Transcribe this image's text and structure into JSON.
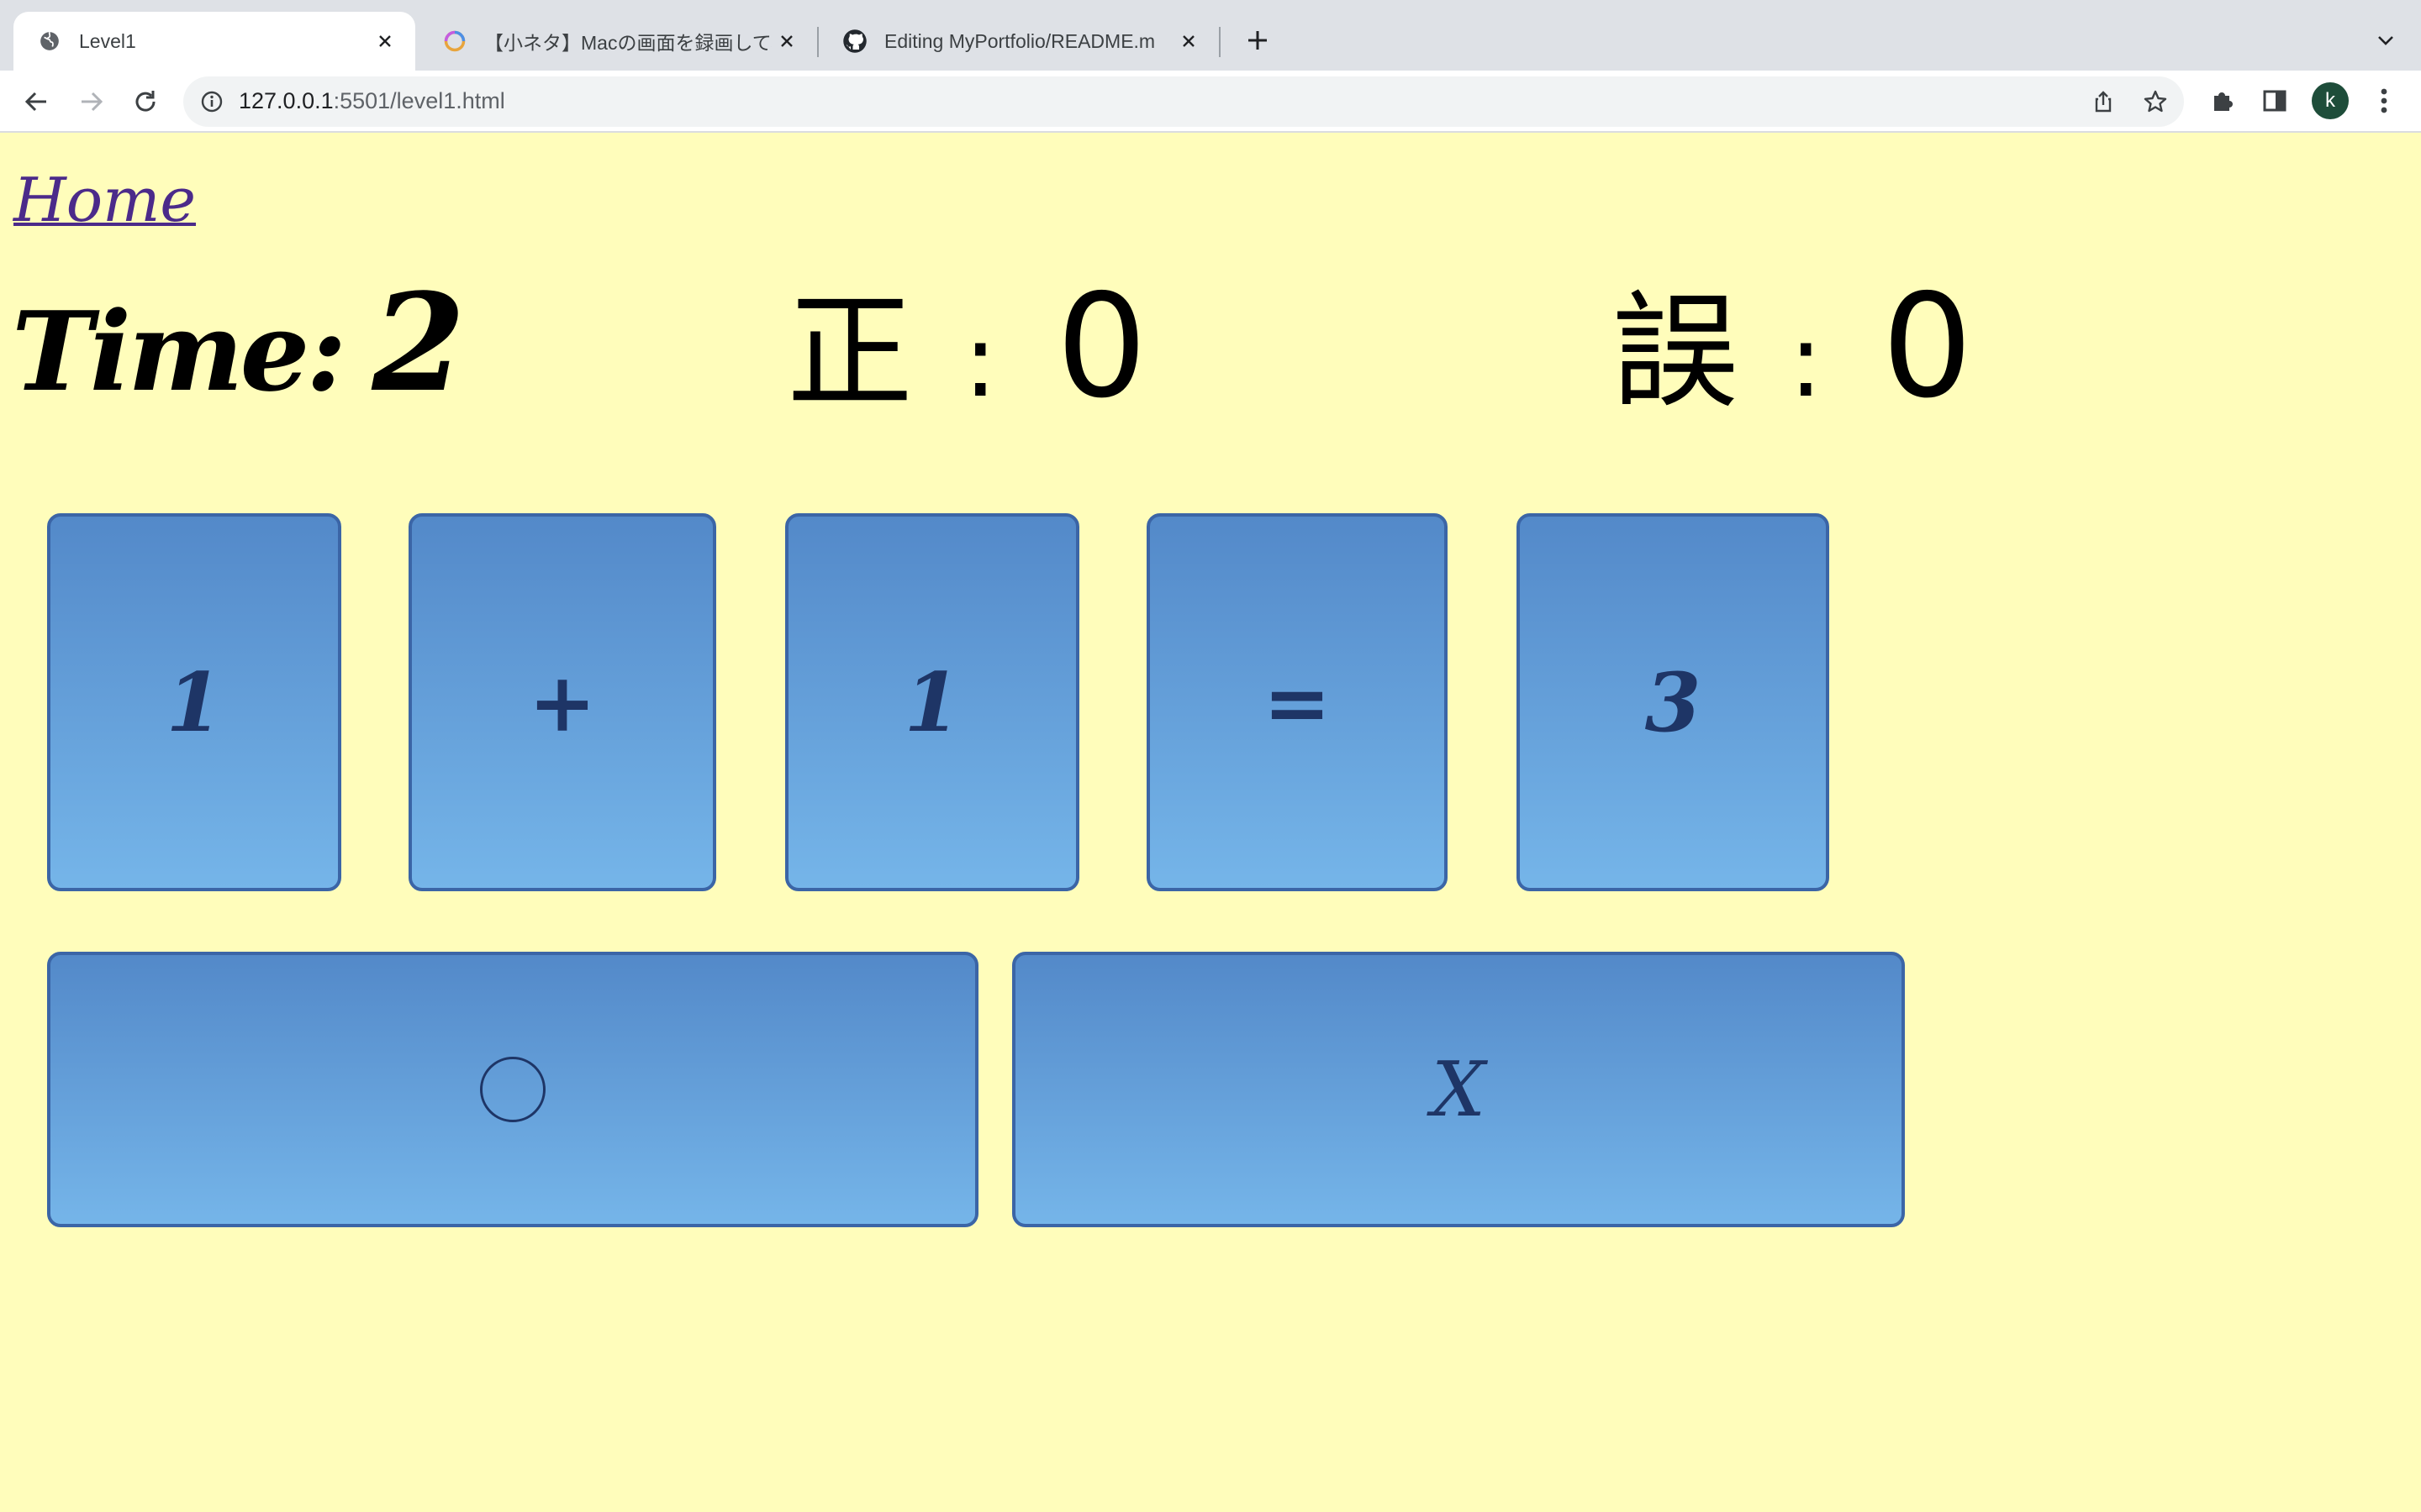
{
  "browser": {
    "tabs": [
      {
        "title": "Level1",
        "active": true,
        "icon": "globe-icon"
      },
      {
        "title": "【小ネタ】Macの画面を録画して、",
        "active": false,
        "icon": "site-logo-icon"
      },
      {
        "title": "Editing MyPortfolio/README.m",
        "active": false,
        "icon": "github-icon"
      }
    ],
    "url_host": "127.0.0.1",
    "url_rest": ":5501/level1.html",
    "profile_initial": "k"
  },
  "page": {
    "home_label": "Home",
    "time_label": "Time:",
    "time_value": "2",
    "correct_label": "正",
    "correct_value": "0",
    "wrong_label": "誤",
    "wrong_value": "0",
    "separator": ":",
    "equation": [
      "1",
      "+",
      "1",
      "=",
      "3"
    ],
    "answer_true": "○",
    "answer_false": "X"
  },
  "colors": {
    "page_background": "#fffdbb",
    "card_top": "#5389c9",
    "card_bottom": "#75b5e9",
    "card_border": "#3b65a6",
    "home_link": "#4b2a8a"
  }
}
